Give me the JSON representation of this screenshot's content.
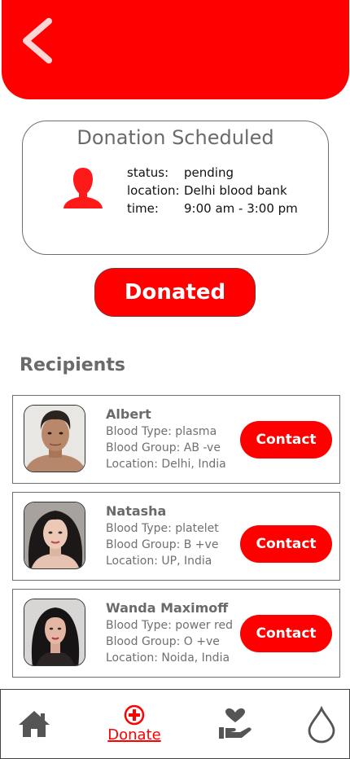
{
  "header": {
    "back_icon": "chevron-left-icon",
    "color": "#ff0000"
  },
  "schedule": {
    "title": "Donation Scheduled",
    "icon": "person-icon",
    "rows": [
      {
        "key": "status:",
        "value": "pending"
      },
      {
        "key": "location:",
        "value": "Delhi blood bank"
      },
      {
        "key": "time:",
        "value": "9:00 am - 3:00 pm"
      }
    ]
  },
  "donated_button": {
    "label": "Donated"
  },
  "recipients": {
    "heading": "Recipients",
    "items": [
      {
        "name": "Albert",
        "blood_type": "Blood Type: plasma",
        "blood_group": "Blood Group: AB -ve",
        "location": "Location: Delhi, India",
        "contact_label": "Contact"
      },
      {
        "name": "Natasha",
        "blood_type": "Blood Type: platelet",
        "blood_group": "Blood Group: B +ve",
        "location": "Location: UP, India",
        "contact_label": "Contact"
      },
      {
        "name": "Wanda Maximoff",
        "blood_type": "Blood Type: power red",
        "blood_group": "Blood Group: O +ve",
        "location": "Location: Noida, India",
        "contact_label": "Contact"
      }
    ]
  },
  "bottom_nav": {
    "home_icon": "home-icon",
    "donate_icon": "plus-circle-icon",
    "donate_label": "Donate",
    "care_icon": "heart-hand-icon",
    "drop_icon": "blood-drop-icon",
    "active_color": "#ff0000"
  }
}
